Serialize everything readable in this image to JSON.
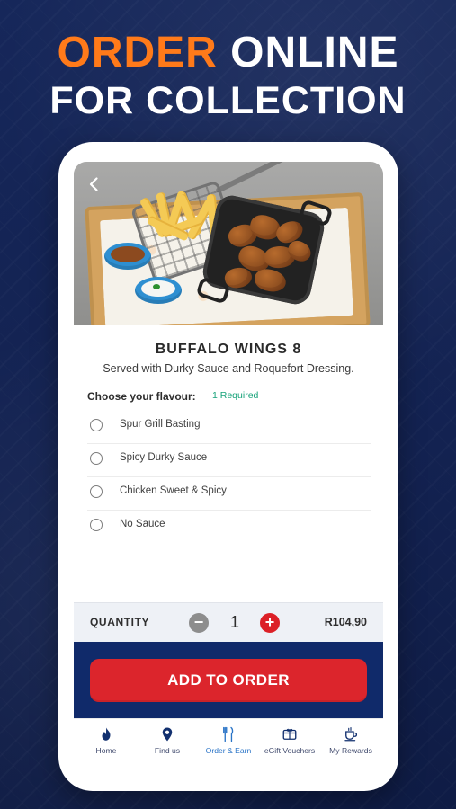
{
  "headline": {
    "line1_accent": "ORDER",
    "line1_rest": "ONLINE",
    "line2": "FOR COLLECTION"
  },
  "item": {
    "title": "BUFFALO WINGS 8",
    "description": "Served with Durky Sauce and Roquefort Dressing."
  },
  "options_section": {
    "label": "Choose your flavour:",
    "required": "1 Required",
    "options": [
      "Spur Grill Basting",
      "Spicy Durky Sauce",
      "Chicken Sweet & Spicy",
      "No Sauce"
    ]
  },
  "quantity": {
    "label": "QUANTITY",
    "value": "1",
    "minus": "−",
    "plus": "+",
    "price": "R104,90"
  },
  "cta": {
    "label": "ADD TO ORDER"
  },
  "nav": [
    {
      "label": "Home",
      "icon": "flame-icon",
      "active": false
    },
    {
      "label": "Find us",
      "icon": "location-icon",
      "active": false
    },
    {
      "label": "Order & Earn",
      "icon": "utensils-icon",
      "active": true
    },
    {
      "label": "eGift Vouchers",
      "icon": "gift-card-icon",
      "active": false
    },
    {
      "label": "My Rewards",
      "icon": "coffee-cup-icon",
      "active": false
    }
  ],
  "colors": {
    "background": "#152556",
    "accent_orange": "#ff7a1a",
    "primary_red": "#dc252c",
    "navy_panel": "#102a6a",
    "success_green": "#18a37a",
    "active_blue": "#2a74c7"
  }
}
